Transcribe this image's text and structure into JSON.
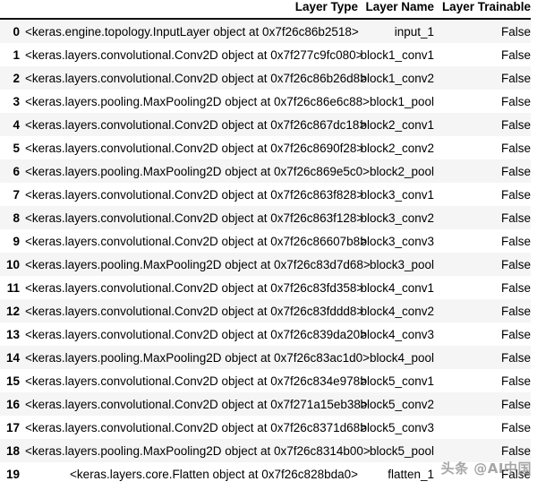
{
  "table": {
    "index_header": "",
    "columns": [
      "Layer Type",
      "Layer Name",
      "Layer Trainable"
    ],
    "rows": [
      {
        "index": "0",
        "layer_type": "<keras.engine.topology.InputLayer object at 0x7f26c86b2518>",
        "layer_name": "input_1",
        "layer_trainable": "False"
      },
      {
        "index": "1",
        "layer_type": "<keras.layers.convolutional.Conv2D object at 0x7f277c9fc080>",
        "layer_name": "block1_conv1",
        "layer_trainable": "False"
      },
      {
        "index": "2",
        "layer_type": "<keras.layers.convolutional.Conv2D object at 0x7f26c86b26d8>",
        "layer_name": "block1_conv2",
        "layer_trainable": "False"
      },
      {
        "index": "3",
        "layer_type": "<keras.layers.pooling.MaxPooling2D object at 0x7f26c86e6c88>",
        "layer_name": "block1_pool",
        "layer_trainable": "False"
      },
      {
        "index": "4",
        "layer_type": "<keras.layers.convolutional.Conv2D object at 0x7f26c867dc18>",
        "layer_name": "block2_conv1",
        "layer_trainable": "False"
      },
      {
        "index": "5",
        "layer_type": "<keras.layers.convolutional.Conv2D object at 0x7f26c8690f28>",
        "layer_name": "block2_conv2",
        "layer_trainable": "False"
      },
      {
        "index": "6",
        "layer_type": "<keras.layers.pooling.MaxPooling2D object at 0x7f26c869e5c0>",
        "layer_name": "block2_pool",
        "layer_trainable": "False"
      },
      {
        "index": "7",
        "layer_type": "<keras.layers.convolutional.Conv2D object at 0x7f26c863f828>",
        "layer_name": "block3_conv1",
        "layer_trainable": "False"
      },
      {
        "index": "8",
        "layer_type": "<keras.layers.convolutional.Conv2D object at 0x7f26c863f128>",
        "layer_name": "block3_conv2",
        "layer_trainable": "False"
      },
      {
        "index": "9",
        "layer_type": "<keras.layers.convolutional.Conv2D object at 0x7f26c86607b8>",
        "layer_name": "block3_conv3",
        "layer_trainable": "False"
      },
      {
        "index": "10",
        "layer_type": "<keras.layers.pooling.MaxPooling2D object at 0x7f26c83d7d68>",
        "layer_name": "block3_pool",
        "layer_trainable": "False"
      },
      {
        "index": "11",
        "layer_type": "<keras.layers.convolutional.Conv2D object at 0x7f26c83fd358>",
        "layer_name": "block4_conv1",
        "layer_trainable": "False"
      },
      {
        "index": "12",
        "layer_type": "<keras.layers.convolutional.Conv2D object at 0x7f26c83fddd8>",
        "layer_name": "block4_conv2",
        "layer_trainable": "False"
      },
      {
        "index": "13",
        "layer_type": "<keras.layers.convolutional.Conv2D object at 0x7f26c839da20>",
        "layer_name": "block4_conv3",
        "layer_trainable": "False"
      },
      {
        "index": "14",
        "layer_type": "<keras.layers.pooling.MaxPooling2D object at 0x7f26c83ac1d0>",
        "layer_name": "block4_pool",
        "layer_trainable": "False"
      },
      {
        "index": "15",
        "layer_type": "<keras.layers.convolutional.Conv2D object at 0x7f26c834e978>",
        "layer_name": "block5_conv1",
        "layer_trainable": "False"
      },
      {
        "index": "16",
        "layer_type": "<keras.layers.convolutional.Conv2D object at 0x7f271a15eb38>",
        "layer_name": "block5_conv2",
        "layer_trainable": "False"
      },
      {
        "index": "17",
        "layer_type": "<keras.layers.convolutional.Conv2D object at 0x7f26c8371d68>",
        "layer_name": "block5_conv3",
        "layer_trainable": "False"
      },
      {
        "index": "18",
        "layer_type": "<keras.layers.pooling.MaxPooling2D object at 0x7f26c8314b00>",
        "layer_name": "block5_pool",
        "layer_trainable": "False"
      },
      {
        "index": "19",
        "layer_type": "<keras.layers.core.Flatten object at 0x7f26c828bda0>",
        "layer_name": "flatten_1",
        "layer_trainable": "False"
      }
    ]
  },
  "watermark": {
    "text": "头条 @AI中国"
  },
  "colors": {
    "stripe": "#f5f5f5",
    "background": "#ffffff",
    "text": "#000000",
    "header_rule": "#111111",
    "watermark": "#9a9a9a"
  }
}
